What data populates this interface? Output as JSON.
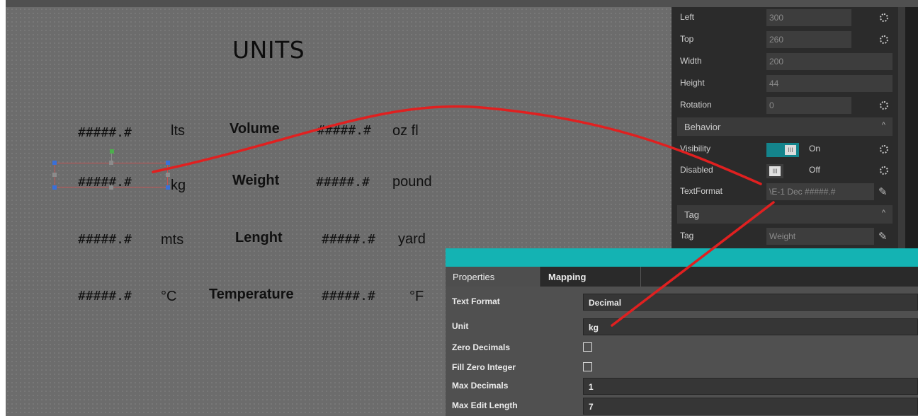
{
  "canvas": {
    "title": "UNITS",
    "rows": [
      {
        "fmt_left": "#####.#",
        "unit_left": "lts",
        "label": "Volume",
        "fmt_right": "#####.#",
        "unit_right": "oz fl"
      },
      {
        "fmt_left": "#####.#",
        "unit_left": "kg",
        "label": "Weight",
        "fmt_right": "#####.#",
        "unit_right": "pound"
      },
      {
        "fmt_left": "#####.#",
        "unit_left": "mts",
        "label": "Lenght",
        "fmt_right": "#####.#",
        "unit_right": "yard"
      },
      {
        "fmt_left": "#####.#",
        "unit_left": "°C",
        "label": "Temperature",
        "fmt_right": "#####.#",
        "unit_right": "°F"
      }
    ]
  },
  "properties": {
    "left": {
      "label": "Left",
      "value": "300"
    },
    "top": {
      "label": "Top",
      "value": "260"
    },
    "width": {
      "label": "Width",
      "value": "200"
    },
    "height": {
      "label": "Height",
      "value": "44"
    },
    "rotation": {
      "label": "Rotation",
      "value": "0"
    },
    "behavior_section": "Behavior",
    "visibility": {
      "label": "Visibility",
      "state": "On"
    },
    "disabled": {
      "label": "Disabled",
      "state": "Off"
    },
    "textformat": {
      "label": "TextFormat",
      "value": "\\E-1 Dec #####.#"
    },
    "tag_section": "Tag",
    "tag": {
      "label": "Tag",
      "value": "Weight"
    },
    "toggle_glyph": "III",
    "collapse_glyph": "^",
    "pencil_glyph": "✎"
  },
  "dialog": {
    "tabs": [
      "Properties",
      "Mapping"
    ],
    "text_format": {
      "label": "Text Format",
      "value": "Decimal"
    },
    "unit": {
      "label": "Unit",
      "value": "kg"
    },
    "zero_decimals": {
      "label": "Zero Decimals",
      "checked": false
    },
    "fill_zero_integer": {
      "label": "Fill Zero Integer",
      "checked": false
    },
    "max_decimals": {
      "label": "Max Decimals",
      "value": "1"
    },
    "max_edit_length": {
      "label": "Max Edit Length",
      "value": "7"
    }
  },
  "colors": {
    "dialog_header": "#14b3b3",
    "annotation_arrow": "#e02020",
    "toggle_on": "#14848c",
    "canvas": "#6c6c6c"
  },
  "icons": [
    "reset-icon",
    "pencil-icon",
    "collapse-icon",
    "toggle-grip-icon"
  ]
}
